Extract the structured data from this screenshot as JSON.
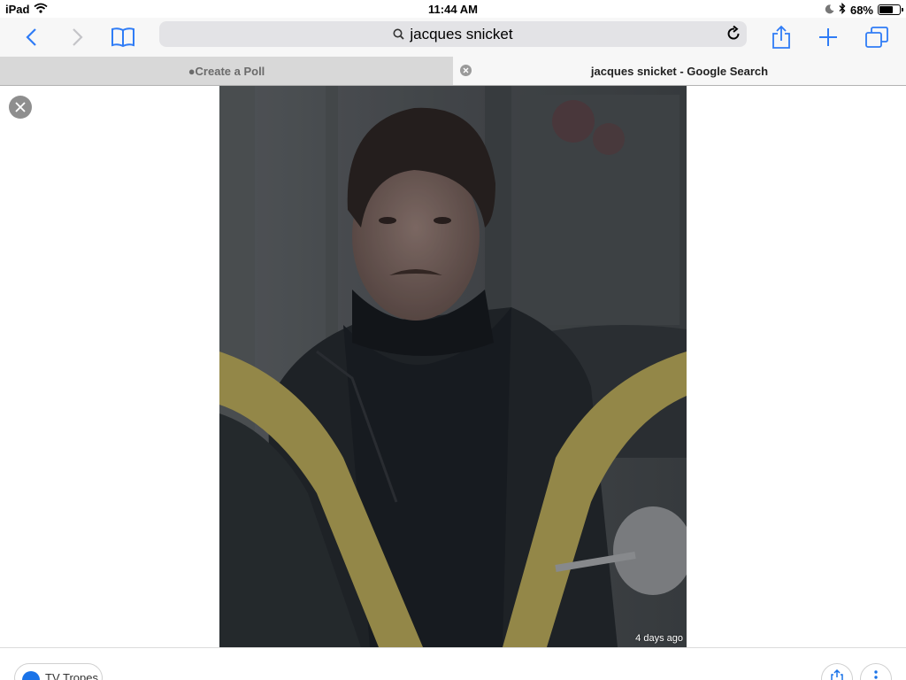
{
  "status_bar": {
    "device": "iPad",
    "time": "11:44 AM",
    "battery": "68%",
    "battery_level": 0.68
  },
  "toolbar": {
    "url_text": "jacques snicket"
  },
  "tabs": [
    {
      "label": "●Create a Poll",
      "active": false
    },
    {
      "label": "jacques snicket - Google Search",
      "active": true
    }
  ],
  "viewer": {
    "timestamp": "4 days ago"
  },
  "bottom": {
    "source_label": "TV Tropes"
  },
  "colors": {
    "accent": "#2f7cf6",
    "toolbar_bg": "#f7f7f7",
    "tab_inactive_bg": "#d8d8d8",
    "url_bar_bg": "#e3e3e6"
  }
}
